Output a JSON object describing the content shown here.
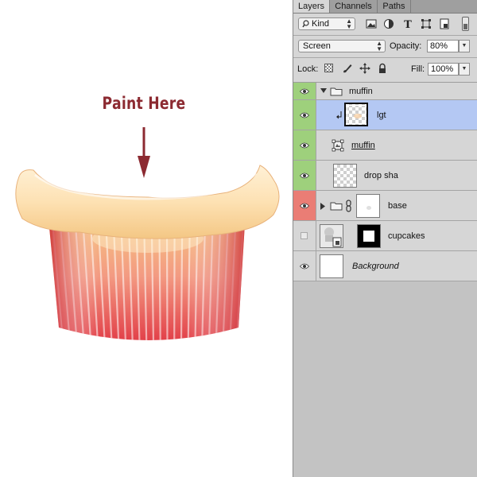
{
  "canvas": {
    "annotation_label": "Paint Here",
    "annotation_color": "#8c2a31"
  },
  "layers_panel": {
    "tabs": [
      {
        "label": "Layers",
        "active": true
      },
      {
        "label": "Channels",
        "active": false
      },
      {
        "label": "Paths",
        "active": false
      }
    ],
    "filter": {
      "value": "Kind",
      "icon": "search-icon"
    },
    "filter_icons": [
      "image-filter-icon",
      "adjustment-filter-icon",
      "type-filter-icon",
      "shape-filter-icon",
      "smart-object-filter-icon",
      "filter-toggle-icon"
    ],
    "blend_mode": "Screen",
    "opacity_label": "Opacity:",
    "opacity_value": "80%",
    "lock_label": "Lock:",
    "lock_icons": [
      "lock-transparent-icon",
      "lock-image-icon",
      "lock-position-icon",
      "lock-all-icon"
    ],
    "fill_label": "Fill:",
    "fill_value": "100%",
    "layers": [
      {
        "name": "muffin",
        "kind": "group",
        "expanded": true,
        "visibility": "green",
        "visible": true
      },
      {
        "name": "lgt",
        "kind": "clipped-layer",
        "visibility": "green",
        "visible": true,
        "selected": true
      },
      {
        "name": "muffin",
        "kind": "smart-object",
        "visibility": "green",
        "visible": true
      },
      {
        "name": "drop sha",
        "kind": "layer",
        "visibility": "green",
        "visible": true
      },
      {
        "name": "base",
        "kind": "group",
        "expanded": false,
        "visibility": "red",
        "visible": true,
        "has_mask": true
      },
      {
        "name": "cupcakes",
        "kind": "smart-object",
        "visibility": "none",
        "visible": false,
        "has_mask": true
      },
      {
        "name": "Background",
        "kind": "background",
        "visibility": "none",
        "visible": true
      }
    ],
    "colors": {
      "selected_row": "#b4c8f3",
      "visibility_green": "#9ed07c",
      "visibility_red": "#ea7d75"
    }
  }
}
